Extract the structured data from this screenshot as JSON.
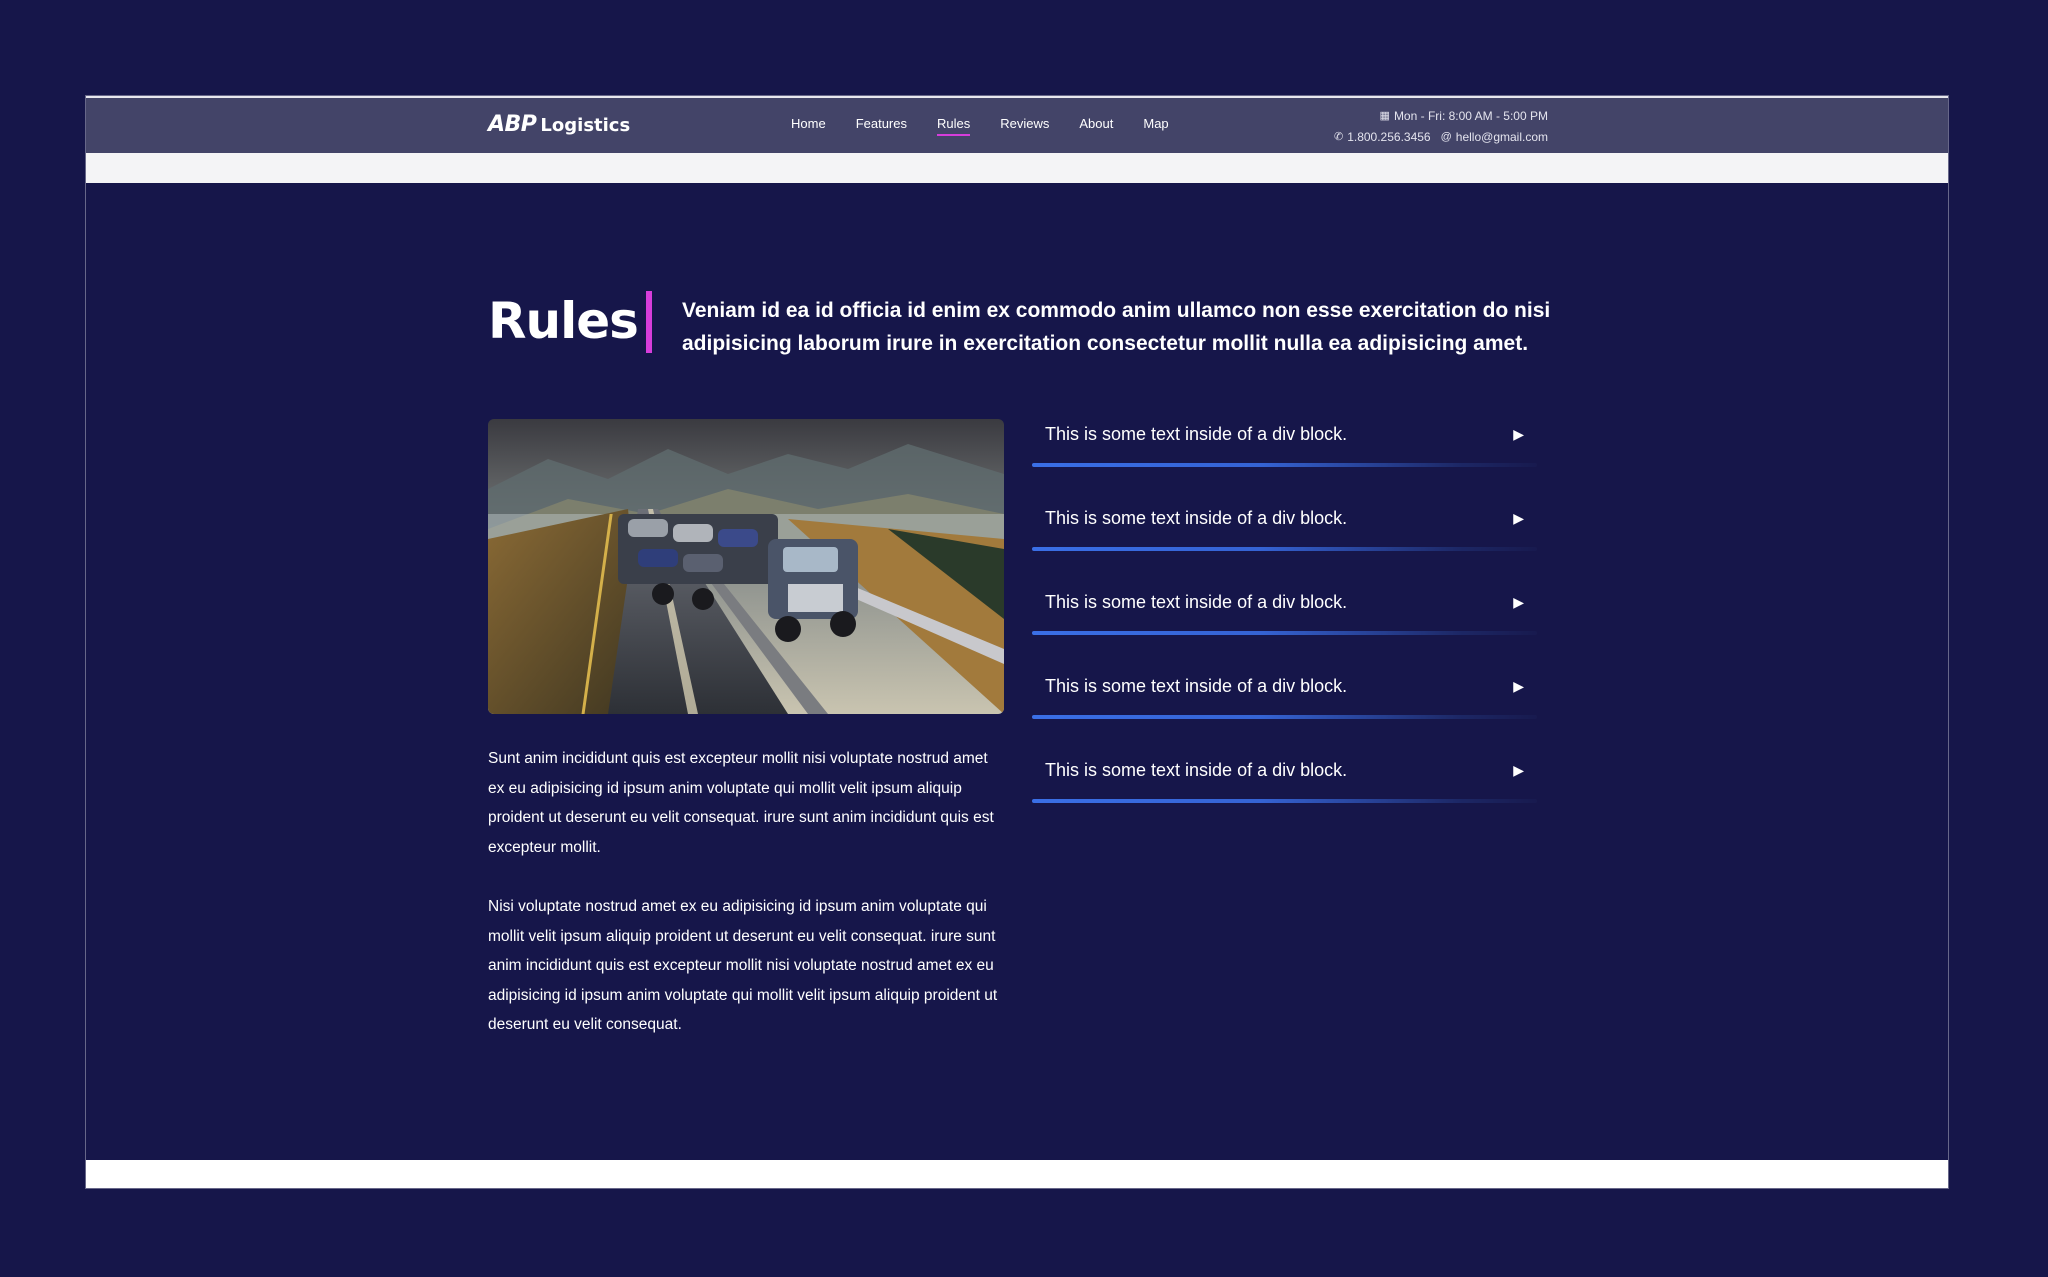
{
  "brand": {
    "mark": "ABP",
    "name": "Logistics"
  },
  "nav": {
    "items": [
      {
        "label": "Home",
        "active": false
      },
      {
        "label": "Features",
        "active": false
      },
      {
        "label": "Rules",
        "active": true
      },
      {
        "label": "Reviews",
        "active": false
      },
      {
        "label": "About",
        "active": false
      },
      {
        "label": "Map",
        "active": false
      }
    ]
  },
  "contact": {
    "hours": "Mon - Fri: 8:00 AM - 5:00 PM",
    "phone": "1.800.256.3456",
    "email": "hello@gmail.com",
    "icons": {
      "hours": "calendar-icon",
      "phone": "phone-icon",
      "email": "at-icon"
    }
  },
  "section": {
    "title": "Rules",
    "intro": "Veniam id ea id officia id enim ex commodo anim ullamco non esse exercitation do nisi adipisicing laborum irure in exercitation consectetur mollit nulla ea adipisicing amet.",
    "paragraphs": [
      "Sunt anim incididunt quis est excepteur mollit nisi voluptate nostrud amet ex eu adipisicing id ipsum anim voluptate qui mollit velit ipsum aliquip proident ut deserunt eu velit consequat. irure sunt anim incididunt quis est excepteur mollit.",
      "Nisi voluptate nostrud amet ex eu adipisicing id ipsum anim voluptate qui mollit velit ipsum aliquip proident ut deserunt eu velit consequat. irure sunt anim incididunt quis est excepteur mollit nisi voluptate nostrud amet ex eu adipisicing id ipsum anim voluptate qui mollit velit ipsum aliquip proident ut deserunt eu velit consequat."
    ],
    "rules": [
      {
        "text": "This is some text inside of a div block.",
        "arrow": "▶"
      },
      {
        "text": "This is some text inside of a div block.",
        "arrow": "▶"
      },
      {
        "text": "This is some text inside of a div block.",
        "arrow": "▶"
      },
      {
        "text": "This is some text inside of a div block.",
        "arrow": "▶"
      },
      {
        "text": "This is some text inside of a div block.",
        "arrow": "▶"
      }
    ]
  },
  "colors": {
    "background": "#16164a",
    "navbar": "#434468",
    "accent": "#d63ddb",
    "rule_line": "#3a6fe6"
  }
}
